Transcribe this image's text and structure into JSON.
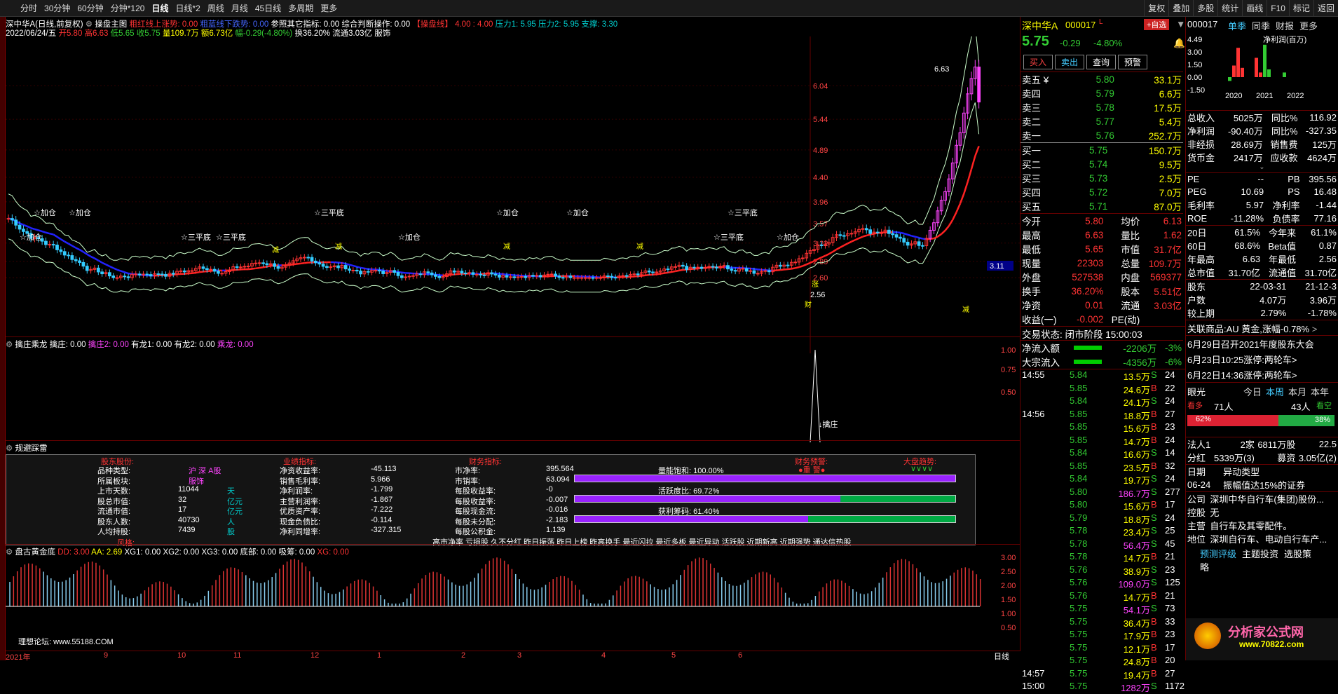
{
  "toolbar": {
    "left": [
      "分时",
      "30分钟",
      "60分钟",
      "分钟*120",
      "日线",
      "日线*2",
      "周线",
      "月线",
      "45日线",
      "多周期",
      "更多"
    ],
    "active": "日线",
    "right": [
      "复权",
      "叠加",
      "多股",
      "统计",
      "画线",
      "F10",
      "标记",
      "返回"
    ]
  },
  "chart": {
    "title": "深中华A(日线,前复权)",
    "indicator": "操盘主图",
    "ind1": "粗红线上涨势: 0.00",
    "ind2": "粗蓝线下跌势: 0.00",
    "ind3": "参照其它指标: 0.00",
    "ind4": "综合判断操作: 0.00",
    "ind5": "【操盘线】",
    "ind6": "4.00 : 4.00",
    "ind7": "压力1: 5.95",
    "ind8": "压力2: 5.95",
    "ind9": "支撑: 3.30",
    "info_date": "2022/06/24/五",
    "info_open": "开5.80",
    "info_high": "高6.63",
    "info_low": "低5.65",
    "info_close": "收5.75",
    "info_vol": "量109.7万",
    "info_amt": "额6.73亿",
    "info_chg": "幅-0.29(-4.80%)",
    "info_turn": "换36.20%",
    "info_cap": "流通3.03亿",
    "info_sector": "服饰",
    "yticks": [
      "6.04",
      "5.44",
      "4.89",
      "4.40",
      "3.96",
      "3.57",
      "3.22",
      "2.89",
      "2.60"
    ],
    "price_tag": "3.11",
    "high_label": "6.63",
    "low_label": "2.56",
    "labels": [
      "加仓",
      "加仓",
      "三平底",
      "三平底",
      "加仓",
      "加仓",
      "三平底",
      "三平底",
      "加仓",
      "加仓",
      "三平底",
      "加仓"
    ],
    "flags": [
      "减",
      "减",
      "减",
      "减",
      "涨",
      "财",
      "减"
    ]
  },
  "sub1": {
    "name": "擒庄乘龙",
    "a": "擒庄: 0.00",
    "b": "擒庄2: 0.00",
    "c": "有龙1: 0.00",
    "d": "有龙2: 0.00",
    "e": "乘龙: 0.00",
    "yticks": [
      "1.00",
      "0.75",
      "0.50"
    ],
    "mark": "擒庄"
  },
  "sub2": {
    "name": "规避踩雷",
    "h1": "股东股份:",
    "h2": "业绩指标:",
    "h3": "财务指标:",
    "h4": "财务预警:",
    "h4b": "●重 警●",
    "h5": "大盘趋势:",
    "h5b": "∨∨∨∨",
    "c1": [
      [
        "品种类型:",
        "沪 深 A股"
      ],
      [
        "所属板块:",
        "服饰"
      ],
      [
        "上市天数:",
        "11044",
        "天"
      ],
      [
        "股总市值:",
        "32",
        "亿元"
      ],
      [
        "流通市值:",
        "17",
        "亿元"
      ],
      [
        "股东人数:",
        "40730",
        "人"
      ],
      [
        "人均持股:",
        "7439",
        "股"
      ]
    ],
    "c2": [
      [
        "净资收益率:",
        "-45.113"
      ],
      [
        "销售毛利率:",
        "5.966"
      ],
      [
        "净利润率:",
        "-1.799"
      ],
      [
        "主营利润率:",
        "-1.867"
      ],
      [
        "优质资产率:",
        "-7.222"
      ],
      [
        "现金负债比:",
        "-0.114"
      ],
      [
        "净利同增率:",
        "-327.315"
      ]
    ],
    "c3": [
      [
        "市净率:",
        "395.564"
      ],
      [
        "市销率:",
        "63.094"
      ],
      [
        "每股收益率:",
        "-0"
      ],
      [
        "每股收益率:",
        "-0.007"
      ],
      [
        "每股现金流:",
        "-0.016"
      ],
      [
        "每股未分配:",
        "-2.183"
      ],
      [
        "每股公积金:",
        "1.139"
      ]
    ],
    "bars": [
      {
        "label": "量能饱和:",
        "val": "100.00%",
        "pct": 100
      },
      {
        "label": "活跃度比:",
        "val": "69.72%",
        "pct": 69.72
      },
      {
        "label": "获利筹码:",
        "val": "61.40%",
        "pct": 61.4
      }
    ],
    "style_label": "风格:",
    "tags": "高市净率 亏损股 久不分红 昨日振荡 昨日上榜 昨高换手 最近闪拉 最近多板 最近异动 活跃股 近期新高 近期强势 通达信热股"
  },
  "sub3": {
    "name": "盘古黄金底",
    "dd": "DD: 3.00",
    "aa": "AA: 2.69",
    "xg1": "XG1: 0.00",
    "xg2": "XG2: 0.00",
    "xg3": "XG3: 0.00",
    "db": "底部: 0.00",
    "xc": "吸筹: 0.00",
    "xg": "XG: 0.00",
    "yticks": [
      "3.00",
      "2.50",
      "2.00",
      "1.50",
      "1.00",
      "0.50"
    ],
    "forum": "理想论坛: www.55188.COM"
  },
  "xaxis": [
    "2021年",
    "9",
    "10",
    "11",
    "12",
    "1",
    "2",
    "3",
    "4",
    "5",
    "6"
  ],
  "xaxis_right": "日线",
  "quote": {
    "name": "深中华A",
    "code": "000017",
    "flag": "L",
    "btn_add": "+自选",
    "price": "5.75",
    "chg": "-0.29",
    "pct": "-4.80%",
    "buttons": [
      "买入",
      "卖出",
      "查询",
      "预警"
    ],
    "asks": [
      [
        "卖五",
        "¥",
        "5.80",
        "33.1万"
      ],
      [
        "卖四",
        "",
        "5.79",
        "6.6万"
      ],
      [
        "卖三",
        "",
        "5.78",
        "17.5万"
      ],
      [
        "卖二",
        "",
        "5.77",
        "5.4万"
      ],
      [
        "卖一",
        "",
        "5.76",
        "252.7万"
      ]
    ],
    "bids": [
      [
        "买一",
        "5.75",
        "150.7万"
      ],
      [
        "买二",
        "5.74",
        "9.5万"
      ],
      [
        "买三",
        "5.73",
        "2.5万"
      ],
      [
        "买四",
        "5.72",
        "7.0万"
      ],
      [
        "买五",
        "5.71",
        "87.0万"
      ]
    ],
    "stats": [
      [
        "今开",
        "5.80",
        "均价",
        "6.13"
      ],
      [
        "最高",
        "6.63",
        "量比",
        "1.62"
      ],
      [
        "最低",
        "5.65",
        "市值",
        "31.7亿"
      ],
      [
        "现量",
        "22303",
        "总量",
        "109.7万"
      ],
      [
        "外盘",
        "527538",
        "内盘",
        "569377"
      ],
      [
        "换手",
        "36.20%",
        "股本",
        "5.51亿"
      ],
      [
        "净资",
        "0.01",
        "流通",
        "3.03亿"
      ],
      [
        "收益(一)",
        "-0.002",
        "PE(动)",
        ""
      ]
    ],
    "status": "交易状态: 闭市阶段 15:00:03",
    "flow": [
      [
        "净流入额",
        "-2206万",
        "-3%"
      ],
      [
        "大宗流入",
        "-4356万",
        "-6%"
      ]
    ],
    "ticks_time1": "14:55",
    "ticks_time2": "14:56",
    "ticks_time3": "14:57",
    "ticks_time4": "15:00",
    "ticks": [
      [
        "5.84",
        "13.5万",
        "S",
        "24"
      ],
      [
        "5.85",
        "24.6万",
        "B",
        "22"
      ],
      [
        "5.84",
        "24.1万",
        "S",
        "24"
      ],
      [
        "5.85",
        "18.8万",
        "B",
        "27"
      ],
      [
        "5.85",
        "15.6万",
        "B",
        "23"
      ],
      [
        "5.85",
        "14.7万",
        "B",
        "24"
      ],
      [
        "5.84",
        "16.6万",
        "S",
        "14"
      ],
      [
        "5.85",
        "23.5万",
        "B",
        "32"
      ],
      [
        "5.84",
        "19.7万",
        "S",
        "24"
      ],
      [
        "5.80",
        "186.7万",
        "S",
        "277"
      ],
      [
        "5.80",
        "15.6万",
        "B",
        "17"
      ],
      [
        "5.79",
        "18.8万",
        "S",
        "24"
      ],
      [
        "5.78",
        "23.4万",
        "S",
        "25"
      ],
      [
        "5.78",
        "56.4万",
        "S",
        "45"
      ],
      [
        "5.78",
        "14.7万",
        "B",
        "21"
      ],
      [
        "5.76",
        "38.9万",
        "S",
        "23"
      ],
      [
        "5.76",
        "109.0万",
        "S",
        "125"
      ],
      [
        "5.76",
        "14.7万",
        "B",
        "21"
      ],
      [
        "5.75",
        "54.1万",
        "S",
        "73"
      ],
      [
        "5.75",
        "36.4万",
        "B",
        "33"
      ],
      [
        "5.75",
        "17.9万",
        "B",
        "23"
      ],
      [
        "5.75",
        "12.1万",
        "B",
        "17"
      ],
      [
        "5.75",
        "24.8万",
        "B",
        "20"
      ],
      [
        "5.75",
        "19.4万",
        "B",
        "27"
      ],
      [
        "5.75",
        "1282万",
        "S",
        "1172"
      ]
    ]
  },
  "fin": {
    "code": "000017",
    "tabs": [
      "单季",
      "同季",
      "财报",
      "更多"
    ],
    "chart_title": "净利润(百万)",
    "chart_y": [
      "4.49",
      "3.00",
      "1.50",
      "0.00",
      "-1.50"
    ],
    "years": [
      "2020",
      "2021",
      "2022"
    ],
    "rows": [
      [
        "总收入",
        "5025万",
        "同比%",
        "116.92"
      ],
      [
        "净利润",
        "-90.40万",
        "同比%",
        "-327.35"
      ],
      [
        "非经损",
        "28.69万",
        "销售费",
        "125万"
      ],
      [
        "货币金",
        "2417万",
        "应收款",
        "4624万"
      ]
    ],
    "rows2": [
      [
        "PE",
        "--",
        "PB",
        "395.56"
      ],
      [
        "PEG",
        "10.69",
        "PS",
        "16.48"
      ],
      [
        "毛利率",
        "5.97",
        "净利率",
        "-1.44"
      ],
      [
        "ROE",
        "-11.28%",
        "负债率",
        "77.16"
      ]
    ],
    "rows3": [
      [
        "20日",
        "61.5%",
        "今年来",
        "61.1%"
      ],
      [
        "60日",
        "68.6%",
        "Beta值",
        "0.87"
      ],
      [
        "年最高",
        "6.63",
        "年最低",
        "2.56"
      ],
      [
        "总市值",
        "31.70亿",
        "流通值",
        "31.70亿"
      ]
    ],
    "rows4": [
      [
        "股东",
        "22-03-31",
        "21-12-3"
      ],
      [
        "户数",
        "4.07万",
        "3.96万"
      ],
      [
        "较上期",
        "2.79%",
        "-1.78%"
      ]
    ],
    "related": "关联商品:AU 黄金,涨幅-0.78%",
    "news": [
      "6月29日召开2021年度股东大会",
      "6月23日10:25涨停:两轮车>",
      "6月22日14:36涨停:两轮车>"
    ],
    "eye": "眼光",
    "eye_tabs": [
      "今日",
      "本周",
      "本月",
      "本年"
    ],
    "bull": "看多",
    "bull_n": "71人",
    "bear_n": "43人",
    "bear": "看空",
    "bull_pct": "62%",
    "bear_pct": "38%",
    "misc": [
      [
        "法人1",
        "2家",
        "6811万股",
        "22.5"
      ],
      [
        "分红",
        "5339万(3)",
        "募资",
        "3.05亿(2)"
      ]
    ],
    "event": [
      [
        "日期",
        "异动类型"
      ],
      [
        "06-24",
        "振幅值达15%的证券"
      ]
    ],
    "company": [
      [
        "公司",
        "深圳中华自行车(集团)股份..."
      ],
      [
        "控股",
        "无"
      ],
      [
        "主营",
        "自行车及其零配件。"
      ],
      [
        "地位",
        "深圳自行车、电动自行车产..."
      ]
    ],
    "links": [
      "预测评级",
      "主题投资",
      "选股策略"
    ],
    "logo_text": "分析家公式网",
    "logo_url": "www.70822.com"
  },
  "colors": {
    "up": "#ff3333",
    "down": "#33cccc",
    "yellow": "#ffff00",
    "bg": "#000000"
  }
}
